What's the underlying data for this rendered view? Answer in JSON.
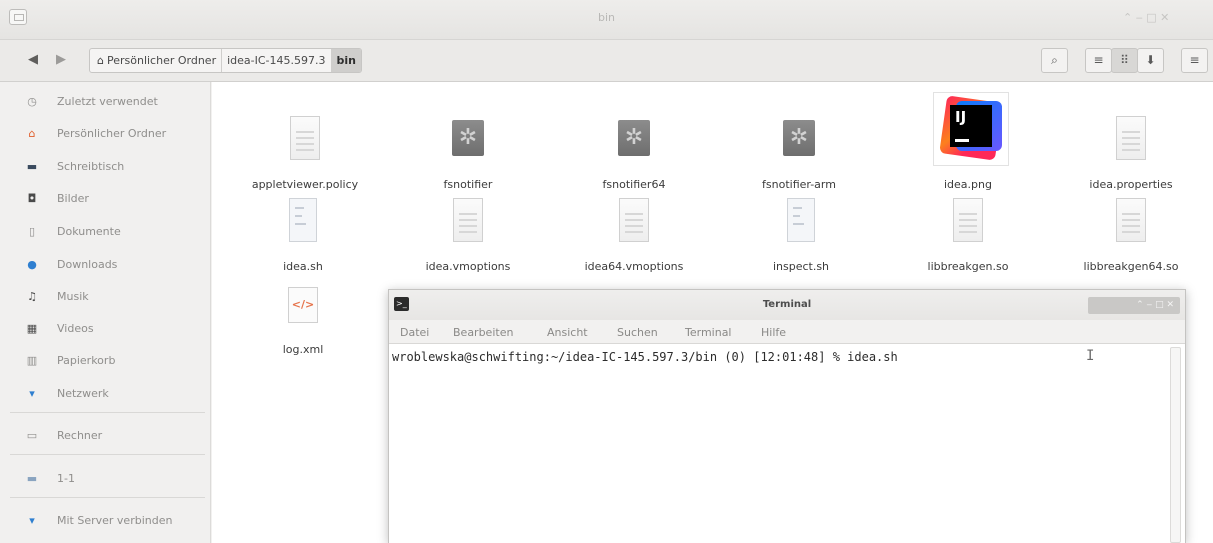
{
  "window": {
    "title": "bin",
    "controls": "⌃ ‒ □ ✕"
  },
  "toolbar": {
    "back_icon": "arrow-left-icon",
    "forward_icon": "arrow-right-icon",
    "breadcrumb": [
      "Persönlicher Ordner",
      "idea-IC-145.597.3",
      "bin"
    ],
    "search_icon": "search-icon",
    "view_icons": [
      "list-view-icon",
      "grid-view-icon",
      "sort-icon",
      "menu-icon"
    ]
  },
  "sidebar": {
    "items": [
      {
        "label": "Zuletzt verwendet",
        "icon": "clock-icon",
        "glyph": "◷"
      },
      {
        "label": "Persönlicher Ordner",
        "icon": "home-icon",
        "glyph": "⌂"
      },
      {
        "label": "Schreibtisch",
        "icon": "desktop-icon",
        "glyph": "▬"
      },
      {
        "label": "Bilder",
        "icon": "pictures-icon",
        "glyph": "◘"
      },
      {
        "label": "Dokumente",
        "icon": "documents-icon",
        "glyph": "▯"
      },
      {
        "label": "Downloads",
        "icon": "downloads-icon",
        "glyph": "●"
      },
      {
        "label": "Musik",
        "icon": "music-icon",
        "glyph": "♫"
      },
      {
        "label": "Videos",
        "icon": "videos-icon",
        "glyph": "▦"
      },
      {
        "label": "Papierkorb",
        "icon": "trash-icon",
        "glyph": "▥"
      },
      {
        "label": "Netzwerk",
        "icon": "network-icon",
        "glyph": "▾"
      },
      {
        "label": "Rechner",
        "icon": "computer-icon",
        "glyph": "▭"
      },
      {
        "label": "1-1",
        "icon": "drive-icon",
        "glyph": "▬"
      },
      {
        "label": "Mit Server verbinden",
        "icon": "connect-server-icon",
        "glyph": "▾"
      }
    ]
  },
  "files": [
    {
      "name": "appletviewer.policy",
      "icon": "text-file-icon"
    },
    {
      "name": "fsnotifier",
      "icon": "executable-icon"
    },
    {
      "name": "fsnotifier64",
      "icon": "executable-icon"
    },
    {
      "name": "fsnotifier-arm",
      "icon": "executable-icon"
    },
    {
      "name": "idea.png",
      "icon": "intellij-image-icon"
    },
    {
      "name": "idea.properties",
      "icon": "text-file-icon"
    },
    {
      "name": "idea.sh",
      "icon": "shell-script-icon"
    },
    {
      "name": "idea.vmoptions",
      "icon": "text-file-icon"
    },
    {
      "name": "idea64.vmoptions",
      "icon": "text-file-icon"
    },
    {
      "name": "inspect.sh",
      "icon": "shell-script-icon"
    },
    {
      "name": "libbreakgen.so",
      "icon": "text-file-icon"
    },
    {
      "name": "libbreakgen64.so",
      "icon": "text-file-icon"
    },
    {
      "name": "log.xml",
      "icon": "xml-file-icon"
    }
  ],
  "terminal": {
    "title": "Terminal",
    "menu": [
      "Datei",
      "Bearbeiten",
      "Ansicht",
      "Suchen",
      "Terminal",
      "Hilfe"
    ],
    "prompt_line": "wroblewska@schwifting:~/idea-IC-145.597.3/bin (0) [12:01:48] % idea.sh",
    "controls": "⌃ ‒ □ ✕"
  },
  "colors": {
    "ij_red": "#fe2857",
    "ij_blue": "#087cfa",
    "sidebar_text": "#8f8e8c"
  }
}
